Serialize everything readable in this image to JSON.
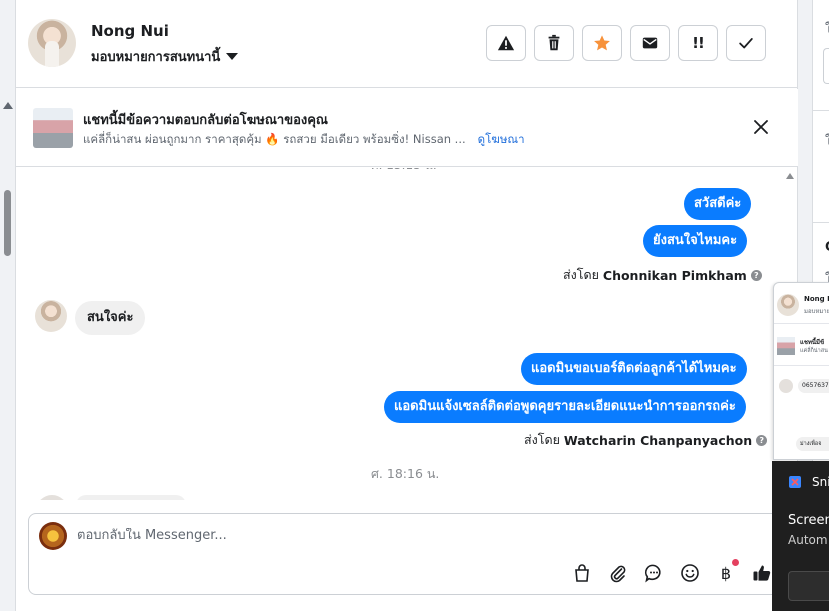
{
  "header": {
    "contact_name": "Nong Nui",
    "assign_label": "มอบหมายการสนทนานี้"
  },
  "ad_banner": {
    "title": "แชทนี้มีข้อความตอบกลับต่อโฆษณาของคุณ",
    "text": "แค่ลี่ก็น่าสน ผ่อนถูกมาก ราคาสุดคุ้ม 🔥 รถสวย มือเดียว พร้อมซิ่ง! Nissan ...",
    "link": "ดูโฆษณา"
  },
  "messages": {
    "out_1": "สวัสดีค่ะ",
    "out_2": "ยังสนใจไหมคะ",
    "sent_by_prefix_1": "ส่งโดย",
    "sent_by_name_1": "Chonnikan Pimkham",
    "in_1": "สนใจค่ะ",
    "out_3": "แอดมินขอเบอร์ติดต่อลูกค้าได้ไหมคะ",
    "out_4": "แอดมินแจ้งเซลล์ติดต่อพูดคุยรายละเอียดแนะนำการออกรถค่ะ",
    "sent_by_prefix_2": "ส่งโดย",
    "sent_by_name_2": "Watcharin Chanpanyachon",
    "date_divider": "ศ. 18:16 น."
  },
  "composer": {
    "placeholder": "ตอบกลับใน Messenger..."
  },
  "mini_preview": {
    "name": "Nong N",
    "sub": "มอบหมาย",
    "ad_title": "แชทนี้มีข้",
    "ad_sub": "แค่ลี่ก็น่าสน",
    "bubble_1": "0657637",
    "bubble_2": "ม่างเพื่อจ"
  },
  "snip_popup": {
    "title": "Sni",
    "heading": "Screen",
    "sub": "Autom"
  },
  "right_column": {
    "letters": [
      "ใ",
      "ใ",
      "C",
      "ใ"
    ]
  },
  "colors": {
    "accent": "#0a7cff",
    "link": "#216fdb",
    "star": "#f7923b"
  }
}
